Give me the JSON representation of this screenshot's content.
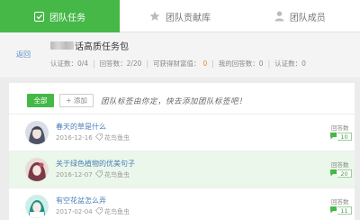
{
  "tabs": [
    {
      "label": "团队任务",
      "icon": "team-task-icon"
    },
    {
      "label": "团队贡献库",
      "icon": "star-icon"
    },
    {
      "label": "团队成员",
      "icon": "person-icon"
    }
  ],
  "header": {
    "back_label": "返回",
    "title_suffix": "话高质任务包",
    "stats": [
      {
        "label": "认证数：0/4"
      },
      {
        "label": "回答数：2/20"
      },
      {
        "label": "可获得财富值：",
        "value": "0"
      },
      {
        "label": "我的回答数：0"
      },
      {
        "label": "认证数：0"
      }
    ]
  },
  "filter": {
    "all_label": "全部",
    "add_label": "+ 添加",
    "hint": "团队标签由你定，快去添加团队标签吧！"
  },
  "questions": [
    {
      "title": "春天的草是什么",
      "date": "2016-12-16",
      "tag": "花鸟鱼虫",
      "answer_label": "回答数",
      "answer_count": "10"
    },
    {
      "title": "关于绿色植物的优美句子",
      "date": "2016-12-07",
      "tag": "花鸟鱼虫",
      "answer_label": "回答数",
      "answer_count": "20"
    },
    {
      "title": "有空花盆怎么弄",
      "date": "2017-02-04",
      "tag": "花鸟鱼虫",
      "answer_label": "回答数",
      "answer_count": "11"
    }
  ],
  "colors": {
    "accent": "#46b847",
    "link": "#4a7fb8",
    "highlight_row": "#eaf7ea"
  }
}
